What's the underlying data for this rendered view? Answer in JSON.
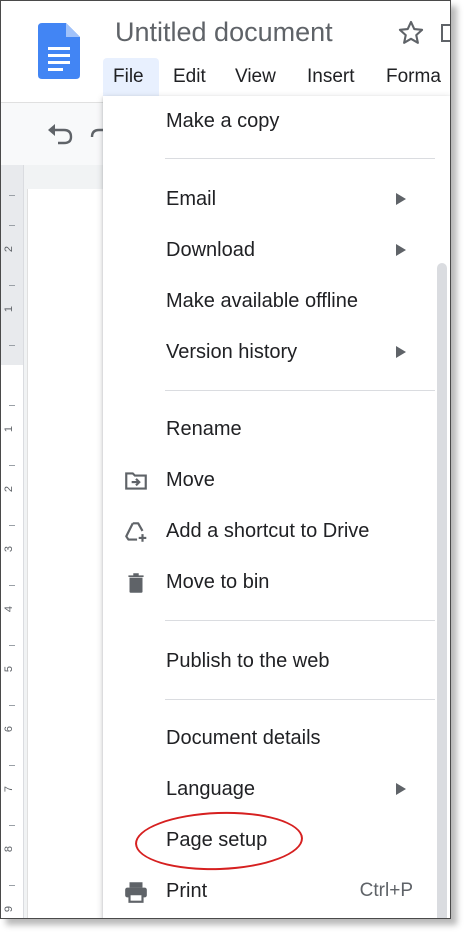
{
  "header": {
    "app_icon": "google-docs-icon",
    "doc_title": "Untitled document",
    "star_icon": "star-outline-icon",
    "move_icon": "folder-move-icon"
  },
  "menubar": {
    "items": [
      "File",
      "Edit",
      "View",
      "Insert",
      "Forma"
    ]
  },
  "toolbar": {
    "undo_icon": "undo-icon",
    "redo_icon": "redo-icon"
  },
  "ruler": {
    "numbers": [
      "2",
      "1",
      "1",
      "2",
      "3",
      "4",
      "5",
      "6",
      "7",
      "8",
      "9"
    ]
  },
  "file_menu": {
    "items": [
      {
        "label": "Make a copy"
      },
      {
        "label": "Email",
        "submenu": true
      },
      {
        "label": "Download",
        "submenu": true
      },
      {
        "label": "Make available offline"
      },
      {
        "label": "Version history",
        "submenu": true
      },
      {
        "label": "Rename"
      },
      {
        "label": "Move",
        "icon": "move-to-folder-icon"
      },
      {
        "label": "Add a shortcut to Drive",
        "icon": "drive-shortcut-icon"
      },
      {
        "label": "Move to bin",
        "icon": "trash-icon"
      },
      {
        "label": "Publish to the web"
      },
      {
        "label": "Document details"
      },
      {
        "label": "Language",
        "submenu": true
      },
      {
        "label": "Page setup"
      },
      {
        "label": "Print",
        "icon": "print-icon",
        "shortcut": "Ctrl+P"
      }
    ]
  },
  "annotation": {
    "highlight_color": "#d62020",
    "highlighted_item": "Page setup"
  },
  "colors": {
    "docs_blue": "#4285f4",
    "active_menu_bg": "#e8f0fe",
    "text": "#202124",
    "muted": "#5f6368"
  }
}
